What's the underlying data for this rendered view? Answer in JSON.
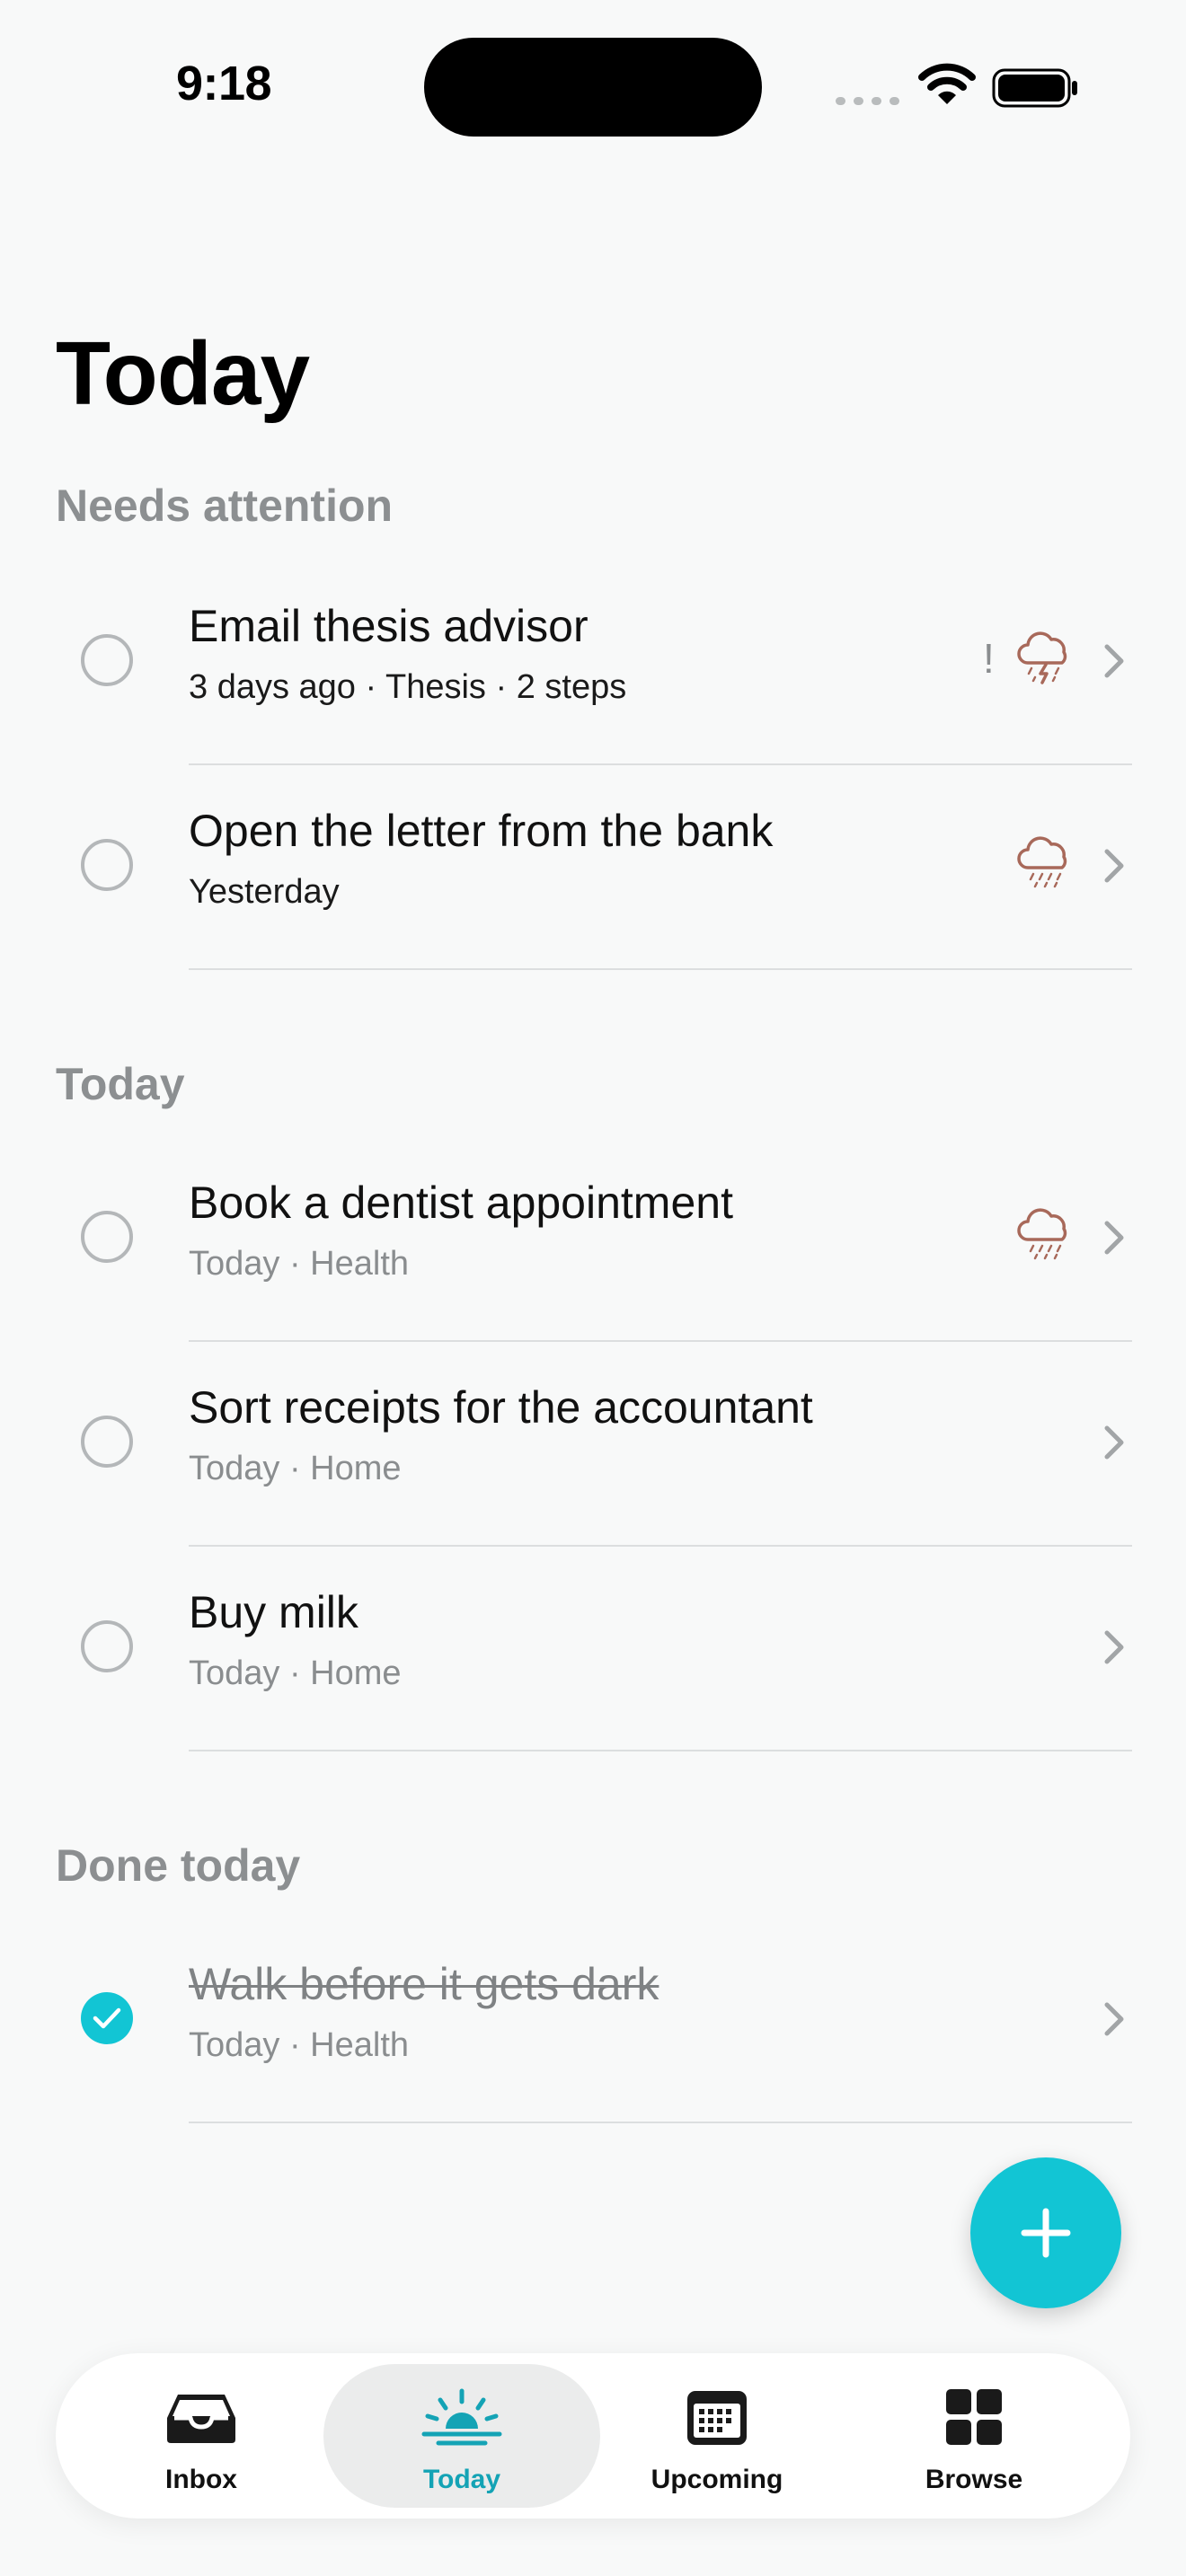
{
  "status_bar": {
    "time": "9:18"
  },
  "page_title": "Today",
  "sections": [
    {
      "header": "Needs attention",
      "tasks": [
        {
          "title": "Email thesis advisor",
          "meta": "3 days ago · Thesis · 2 steps",
          "priority": "!",
          "weather_icon": "thunderstorm-cloud-icon"
        },
        {
          "title": "Open the letter from the bank",
          "meta": "Yesterday",
          "weather_icon": "rain-cloud-icon"
        }
      ]
    },
    {
      "header": "Today",
      "tasks": [
        {
          "title": "Book a dentist appointment",
          "meta": "Today · Health",
          "weather_icon": "rain-cloud-icon"
        },
        {
          "title": "Sort receipts for the accountant",
          "meta": "Today · Home"
        },
        {
          "title": "Buy milk",
          "meta": "Today · Home"
        }
      ]
    },
    {
      "header": "Done today",
      "tasks": [
        {
          "title": "Walk before it gets dark",
          "meta": "Today · Health",
          "completed": true
        }
      ]
    }
  ],
  "tab_bar": {
    "tabs": [
      {
        "label": "Inbox",
        "icon": "inbox-tray-icon"
      },
      {
        "label": "Today",
        "icon": "sunrise-icon",
        "active": true
      },
      {
        "label": "Upcoming",
        "icon": "calendar-icon"
      },
      {
        "label": "Browse",
        "icon": "grid-icon"
      }
    ]
  },
  "colors": {
    "accent": "#12c5d4",
    "active_tab_label": "#14a3b5",
    "weather_icon": "#a8695a",
    "section_header": "#8c8f91",
    "background": "#f8f9f9"
  }
}
